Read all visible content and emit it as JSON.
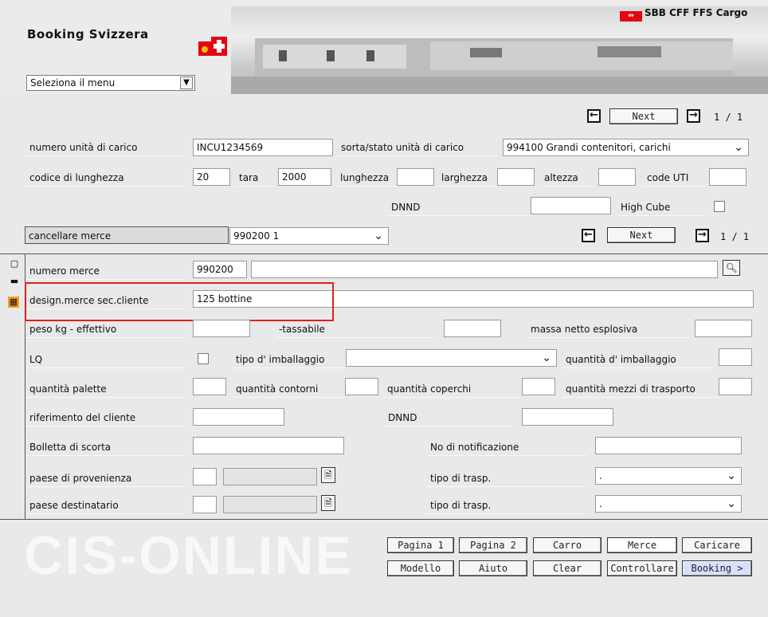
{
  "header": {
    "app_title": "Booking Svizzera",
    "menu_select": "Seleziona il menu",
    "brand": "SBB CFF FFS Cargo"
  },
  "pager_top": {
    "next": "Next",
    "page": "1 / 1"
  },
  "unit": {
    "numero_unita_label": "numero unità di carico",
    "numero_unita_value": "INCU1234569",
    "sorta_label": "sorta/stato unità di carico",
    "sorta_value": "994100  Grandi contenitori, carichi",
    "codice_lunghezza_label": "codice di lunghezza",
    "codice_lunghezza_value": "20",
    "tara_label": "tara",
    "tara_value": "2000",
    "lunghezza_label": "lunghezza",
    "larghezza_label": "larghezza",
    "altezza_label": "altezza",
    "code_uti_label": "code UTI",
    "dnnd_label": "DNND",
    "high_cube_label": "High Cube"
  },
  "merce_bar": {
    "cancellare_label": "cancellare merce",
    "merce_select": "990200  1",
    "next": "Next",
    "page": "1 / 1"
  },
  "merce": {
    "numero_merce_label": "numero merce",
    "numero_merce_value": "990200",
    "design_label": "design.merce sec.cliente",
    "design_value": "125 bottine",
    "peso_label": "peso kg - effettivo",
    "tassabile_label": "-tassabile",
    "massa_label": "massa netto esplosiva",
    "lq_label": "LQ",
    "tipo_imballaggio_label": "tipo d' imballaggio",
    "quantita_imballaggio_label": "quantità d' imballaggio",
    "quantita_palette_label": "quantità palette",
    "quantita_contorni_label": "quantità contorni",
    "quantita_coperchi_label": "quantità coperchi",
    "quantita_mezzi_label": "quantità mezzi di trasporto",
    "riferimento_label": "riferimento del cliente",
    "dnnd_label": "DNND",
    "bolletta_label": "Bolletta di scorta",
    "notificazione_label": "No di notificazione",
    "paese_provenienza_label": "paese di provenienza",
    "paese_destinatario_label": "paese destinatario",
    "tipo_trasp_label": "tipo di trasp.",
    "tipo_trasp_value": "."
  },
  "footer": {
    "logo_text": "CIS-ONLINE",
    "buttons_row1": [
      "Pagina 1",
      "Pagina 2",
      "Carro",
      "Merce",
      "Caricare"
    ],
    "buttons_row2": [
      "Modello",
      "Aiuto",
      "Clear",
      "Controllare",
      "Booking >"
    ]
  },
  "colors": {
    "highlight": "#e02020",
    "brand_red": "#e30613",
    "booking_button": "#d7e0ff"
  }
}
